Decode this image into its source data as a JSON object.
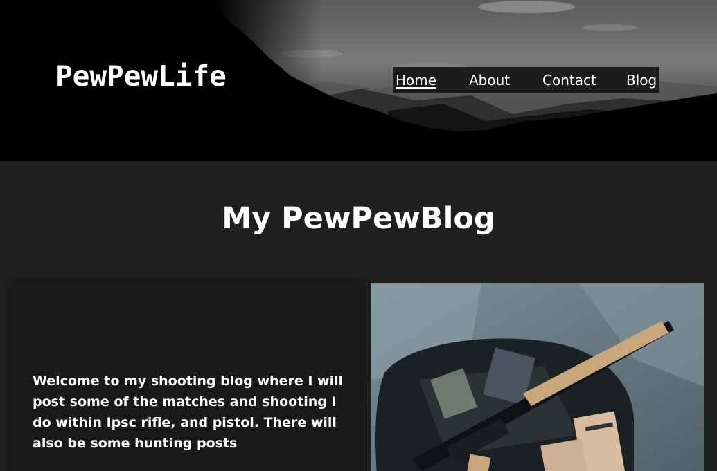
{
  "header": {
    "logo": "PewPewLife",
    "hero_image": "mountain-landscape-image"
  },
  "nav": {
    "items": [
      {
        "label": "Home",
        "active": true
      },
      {
        "label": "About",
        "active": false
      },
      {
        "label": "Contact",
        "active": false
      },
      {
        "label": "Blog",
        "active": false
      }
    ]
  },
  "main": {
    "title": "My PewPewBlog",
    "intro_text": "Welcome to my shooting blog where I will post some of the matches and shooting I do within Ipsc rifle, and pistol. There will also be some hunting posts",
    "photo": "rifle-in-range-bag-image"
  },
  "colors": {
    "header_bg": "#000000",
    "page_bg": "#1f1f1f",
    "card_bg": "#191919",
    "nav_bg": "#1c1c1c",
    "text": "#ffffff"
  }
}
